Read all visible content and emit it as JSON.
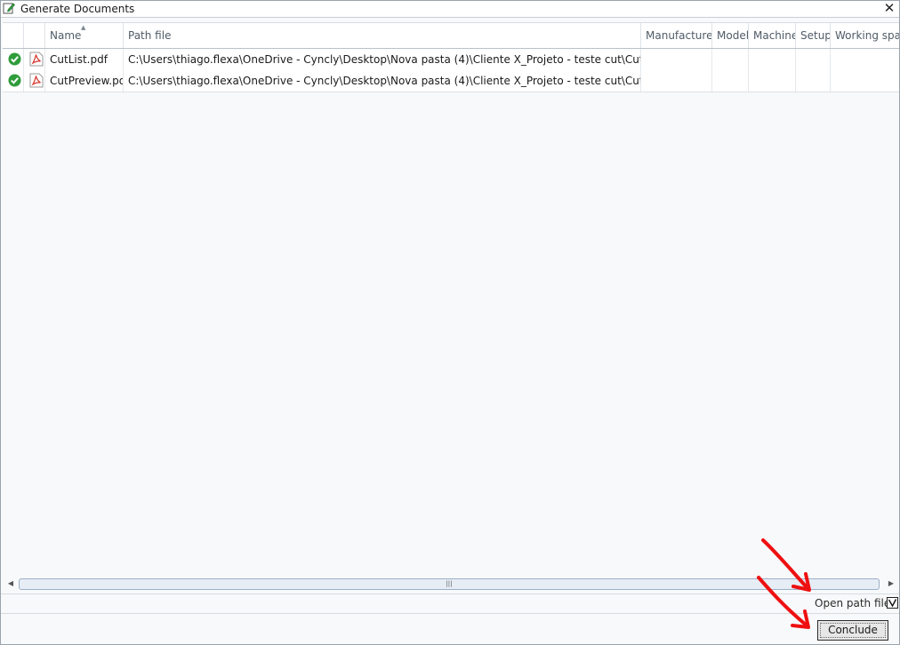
{
  "window": {
    "title": "Generate Documents"
  },
  "grid": {
    "columns": {
      "name": "Name",
      "path": "Path file",
      "manufacturer": "Manufacturer",
      "model": "Model",
      "machine": "Machine",
      "setup": "Setup",
      "workspace": "Working spac"
    },
    "rows": [
      {
        "name": "CutList.pdf",
        "path": "C:\\Users\\thiago.flexa\\OneDrive - Cyncly\\Desktop\\Nova pasta (4)\\Cliente X_Projeto - teste cut\\CutList.pdf",
        "status_icon": "success-check-icon",
        "file_icon": "pdf-icon"
      },
      {
        "name": "CutPreview.pdf",
        "path": "C:\\Users\\thiago.flexa\\OneDrive - Cyncly\\Desktop\\Nova pasta (4)\\Cliente X_Projeto - teste cut\\CutPreview.pdf",
        "status_icon": "success-check-icon",
        "file_icon": "pdf-icon"
      }
    ]
  },
  "footer": {
    "open_path_label": "Open path file",
    "conclude_label": "Conclude"
  },
  "colors": {
    "success": "#2e9c3a",
    "pdf": "#d4352b",
    "annotation": "#ee1010"
  }
}
